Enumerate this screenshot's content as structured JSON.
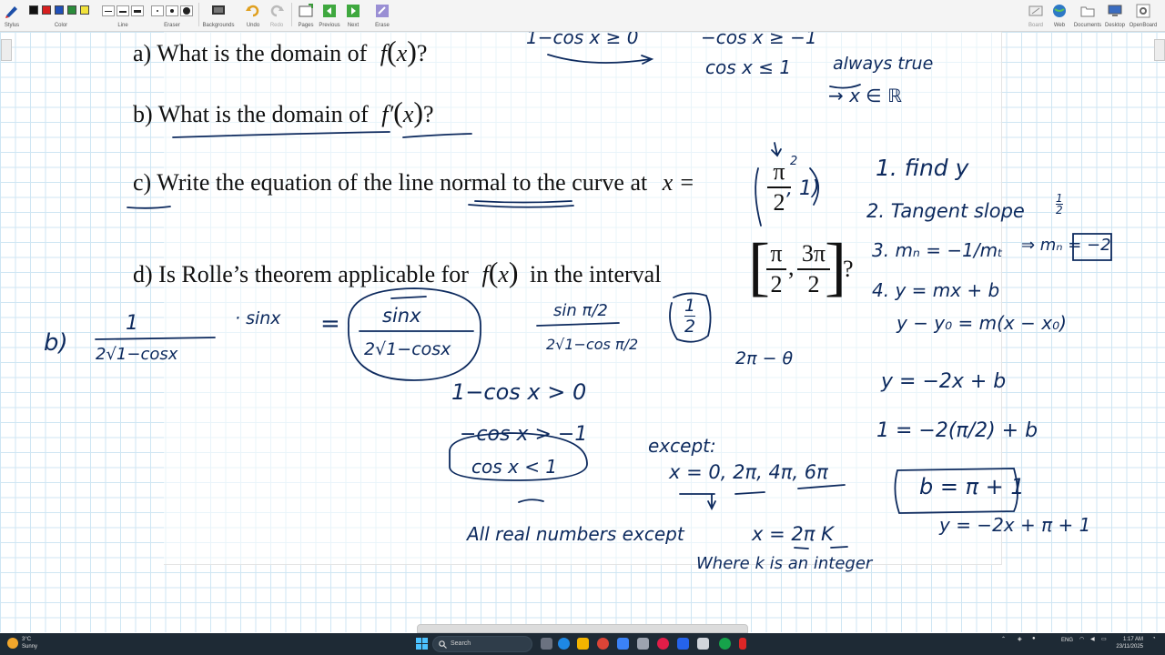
{
  "toolbar": {
    "stylus_label": "Stylus",
    "color_label": "Color",
    "line_label": "Line",
    "eraser_label": "Eraser",
    "backgrounds_label": "Backgrounds",
    "undo_label": "Undo",
    "redo_label": "Redo",
    "pages_label": "Pages",
    "previous_label": "Previous",
    "next_label": "Next",
    "erase_label": "Erase",
    "board_label": "Board",
    "web_label": "Web",
    "documents_label": "Documents",
    "desktop_label": "Desktop",
    "openboard_label": "OpenBoard",
    "colors": [
      "#111111",
      "#d71f1f",
      "#1f4fb8",
      "#2a8c3a",
      "#f1e23a"
    ]
  },
  "questions": {
    "a": {
      "prefix": "a) What is the domain of",
      "func": "f",
      "arg": "x",
      "suffix": "?"
    },
    "b": {
      "prefix": "b) What is the domain of",
      "func": "f′",
      "arg": "x",
      "suffix": "?"
    },
    "c": {
      "prefix": "c) Write the equation of the line normal to the curve at",
      "var": "x =",
      "frac_num": "π",
      "frac_den": "2"
    },
    "d": {
      "prefix": "d) Is Rolle’s theorem applicable for",
      "func": "f",
      "arg": "x",
      "mid": "in the interval",
      "frac1_num": "π",
      "frac1_den": "2",
      "frac2_num": "3π",
      "frac2_den": "2",
      "suffix": "?"
    }
  },
  "handwriting": {
    "top_ineq_1": "1−cos x ≥ 0",
    "top_ineq_2": "−cos x ≥ −1",
    "top_ineq_3": "cos x ≤ 1",
    "always_true": "always true",
    "x_in_R": "→ x ∈ ℝ",
    "c_point_tail": ", 1)",
    "c_point_mark": "2",
    "steps": {
      "s1": "1. find y",
      "s2": "2. Tangent slope",
      "s2_frac_num": "1",
      "s2_frac_den": "2",
      "s3": "3. mₙ = −1/mₜ",
      "s3_result": "⇒ mₙ = −2",
      "s4": "4. y = mx + b",
      "s4b": "y − y₀ = m(x − x₀)"
    },
    "b_work": {
      "label": "b)",
      "num": "1",
      "den": "2√1−cosx",
      "times": "· sinx",
      "eq": "=",
      "circ_num": "sinx",
      "circ_den": "2√1−cosx",
      "sub_num": "sin π/2",
      "sub_den": "2√1−cos π/2",
      "sub_result_num": "1",
      "sub_result_den": "2",
      "two_pi": "2π − θ",
      "ineq1": "1−cos x > 0",
      "ineq2": "−cos x > −1",
      "ineq3": "cos x < 1",
      "except": "except:",
      "except_vals": "x = 0, 2π, 4π, 6π",
      "all_real": "All real numbers except",
      "x_eq": "x = 2π K",
      "where_k": "Where k is an integer"
    },
    "c_work": {
      "line1": "y = −2x + b",
      "line2": "1 = −2(π/2) + b",
      "boxed": "b = π + 1",
      "final": "y = −2x + π + 1"
    }
  },
  "taskbar": {
    "temp": "3°C",
    "weather": "Sunny",
    "search_placeholder": "Search",
    "lang": "ENG",
    "time": "1:17 AM",
    "date": "23/11/2025"
  }
}
